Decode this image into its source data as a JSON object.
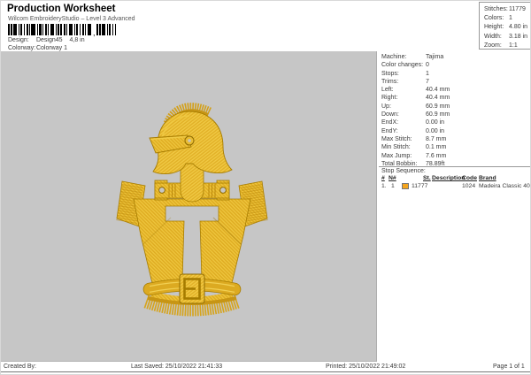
{
  "header": {
    "title": "Production Worksheet",
    "subtitle": "Wilcom EmbroideryStudio – Level 3 Advanced",
    "barcode_separator": ",",
    "design_label": "Design:",
    "design_name": "Design45",
    "design_size": "4,8 in",
    "colorway_label": "Colorway:",
    "colorway_value": "Colorway 1"
  },
  "stats_box": {
    "rows": [
      {
        "label": "Stitches:",
        "value": "11779"
      },
      {
        "label": "Colors:",
        "value": "1"
      },
      {
        "label": "Height:",
        "value": "4.80 in"
      },
      {
        "label": "Width:",
        "value": "3.18 in"
      },
      {
        "label": "Zoom:",
        "value": "1:1"
      }
    ]
  },
  "machine_panel": {
    "rows": [
      {
        "label": "Machine:",
        "value": "Tajima"
      },
      {
        "label": "Color changes:",
        "value": "0"
      },
      {
        "label": "Stops:",
        "value": "1"
      },
      {
        "label": "Trims:",
        "value": "7"
      },
      {
        "label": "Left:",
        "value": "40.4 mm"
      },
      {
        "label": "Right:",
        "value": "40.4 mm"
      },
      {
        "label": "Up:",
        "value": "60.9 mm"
      },
      {
        "label": "Down:",
        "value": "60.9 mm"
      },
      {
        "label": "EndX:",
        "value": "0.00 in"
      },
      {
        "label": "EndY:",
        "value": "0.00 in"
      },
      {
        "label": "Max Stitch:",
        "value": "8.7 mm"
      },
      {
        "label": "Min Stitch:",
        "value": "0.1 mm"
      },
      {
        "label": "Max Jump:",
        "value": "7.6 mm"
      },
      {
        "label": "Total Bobbin:",
        "value": "78.89ft"
      }
    ],
    "stop_sequence": {
      "title": "Stop Sequence:",
      "columns": [
        "#",
        "N#",
        "St.",
        "Description",
        "Code",
        "Brand"
      ],
      "rows": [
        {
          "num": "1.",
          "n": "1",
          "swatch_color": "#F5A51D",
          "st": "11777",
          "description": "",
          "code": "1024",
          "brand": "Madeira Classic 40"
        }
      ]
    }
  },
  "design_preview": {
    "description": "Gold embroidery design of a Spartan/knight helmet with crest above an armored torso with a cross cutout, belt and fringe skirt",
    "thread_color": "#DFAC22",
    "canvas_color": "#C6C6C6"
  },
  "footer": {
    "created_by": "Created By:",
    "last_saved": "Last Saved: 25/10/2022 21:41:33",
    "printed": "Printed: 25/10/2022 21:49:02",
    "page": "Page 1 of 1"
  }
}
